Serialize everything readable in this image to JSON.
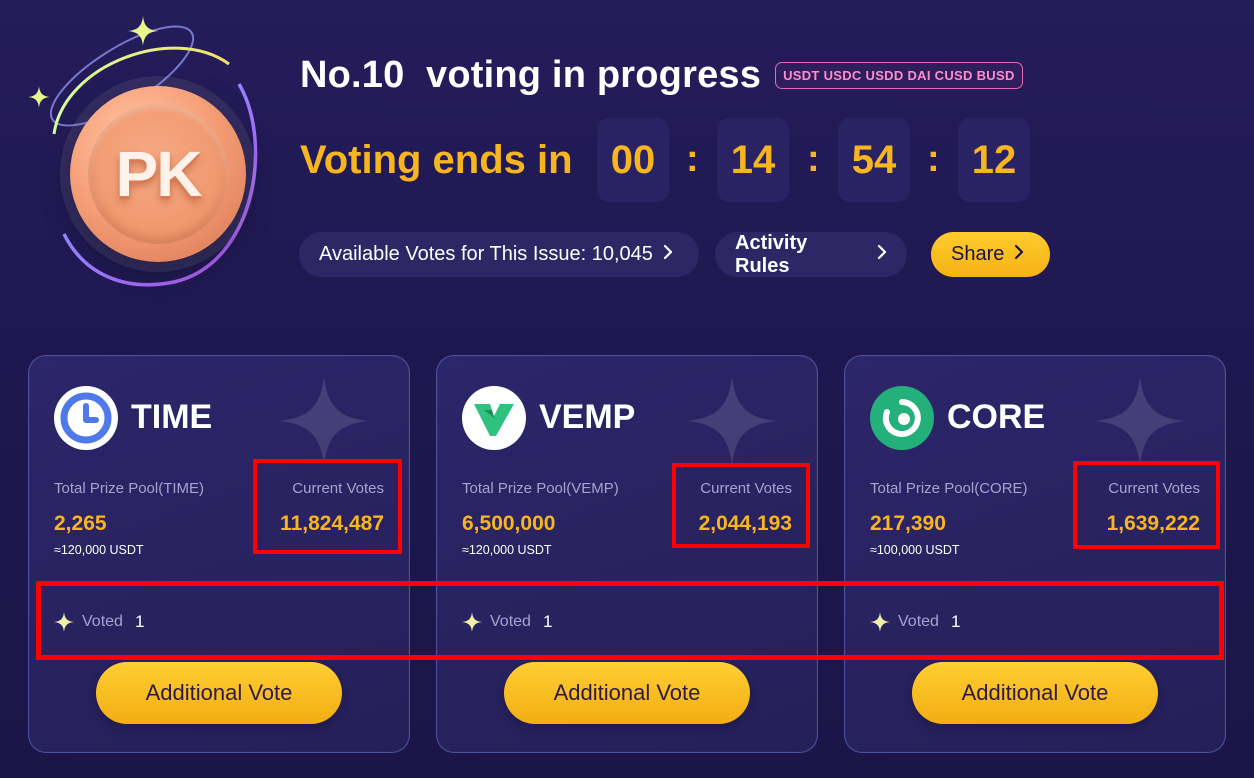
{
  "header": {
    "logo_text": "PK",
    "title": "No.10  voting in progress",
    "tokens_badge": "USDT USDC USDD DAI CUSD BUSD",
    "countdown_label": "Voting ends in",
    "countdown": [
      "00",
      "14",
      "54",
      "12"
    ],
    "separator": ":",
    "available_votes": "Available Votes for This Issue: 10,045",
    "activity_rules": "Activity Rules",
    "share": "Share"
  },
  "cards": [
    {
      "token": "TIME",
      "pool_label": "Total Prize Pool(TIME)",
      "pool_value": "2,265",
      "pool_usdt": "≈120,000 USDT",
      "votes_label": "Current Votes",
      "votes_value": "11,824,487",
      "voted_label": "Voted",
      "voted_count": "1",
      "button": "Additional Vote"
    },
    {
      "token": "VEMP",
      "pool_label": "Total Prize Pool(VEMP)",
      "pool_value": "6,500,000",
      "pool_usdt": "≈120,000 USDT",
      "votes_label": "Current Votes",
      "votes_value": "2,044,193",
      "voted_label": "Voted",
      "voted_count": "1",
      "button": "Additional Vote"
    },
    {
      "token": "CORE",
      "pool_label": "Total Prize Pool(CORE)",
      "pool_value": "217,390",
      "pool_usdt": "≈100,000 USDT",
      "votes_label": "Current Votes",
      "votes_value": "1,639,222",
      "voted_label": "Voted",
      "voted_count": "1",
      "button": "Additional Vote"
    }
  ],
  "colors": {
    "accent": "#f7b51f",
    "highlight": "#ff0000",
    "badge": "#e36bb2"
  },
  "icons": [
    "pk-coin-icon",
    "sparkle-icon",
    "chevron-right-icon",
    "time-clock-icon",
    "vemp-v-icon",
    "core-ring-icon",
    "star-watermark-icon"
  ]
}
